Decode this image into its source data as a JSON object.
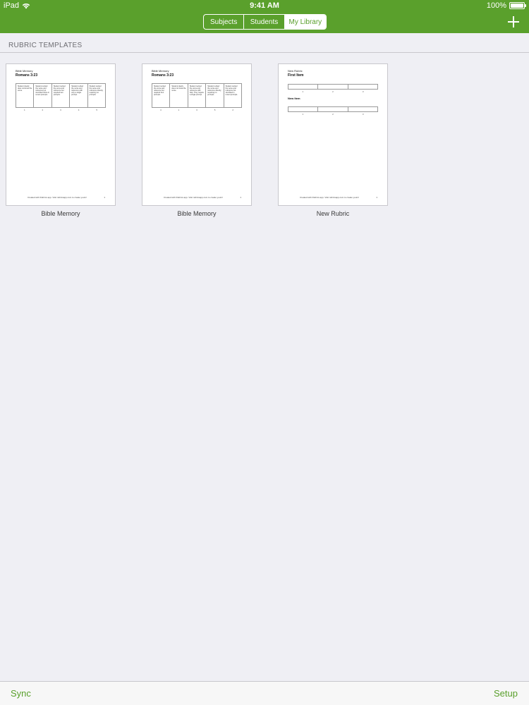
{
  "status_bar": {
    "device": "iPad",
    "time": "9:41 AM",
    "battery": "100%",
    "battery_level": 1.0
  },
  "nav": {
    "tabs": [
      {
        "label": "Subjects",
        "active": false
      },
      {
        "label": "Students",
        "active": false
      },
      {
        "label": "My Library",
        "active": true
      }
    ]
  },
  "section": {
    "title": "RUBRIC TEMPLATES"
  },
  "templates": [
    {
      "name": "Bible Memory",
      "doc_small": "Bible Memory",
      "doc_title": "Romans 3:23",
      "criteria": [
        "Student clearly does not know the verse.",
        "Student recited the verse and reference but stumbled thrice in recent prompts.",
        "Student recited the verse and reference but required two prompts.",
        "Student recited the verse and reference with only a single prompt.",
        "Student recited the verse and reference directly, requiring no prompts."
      ],
      "scores": [
        "1",
        "2",
        "3",
        "4",
        "5"
      ],
      "footer": "Created with Rubrics app. Visit rubricsapp.com to create yours!",
      "page": "1"
    },
    {
      "name": "Bible Memory",
      "doc_small": "Bible Memory",
      "doc_title": "Romans 3:23",
      "criteria": [
        "Student recited the verse and reference but required four prompts.",
        "Student clearly does not know the verse.",
        "Student recited the verse and reference with help. They require a single prompt.",
        "Student recited the verse and reference directly, requiring no prompts.",
        "Student recited the verse and reference but stumbled in recent prompts."
      ],
      "scores": [
        "4",
        "1",
        "3",
        "5",
        "2"
      ],
      "footer": "Created with Rubrics app. Visit rubricsapp.com to create yours!",
      "page": "1"
    },
    {
      "name": "New Rubric",
      "doc_small": "New Rubric",
      "doc_title": "First Item",
      "second_item": "New Item",
      "scores": [
        "1",
        "2",
        "3"
      ],
      "footer": "Created with Rubrics app. Visit rubricsapp.com to create yours!",
      "page": "1"
    }
  ],
  "bottom_bar": {
    "left": "Sync",
    "right": "Setup"
  },
  "colors": {
    "accent": "#5aa02c",
    "background": "#efeff4"
  }
}
